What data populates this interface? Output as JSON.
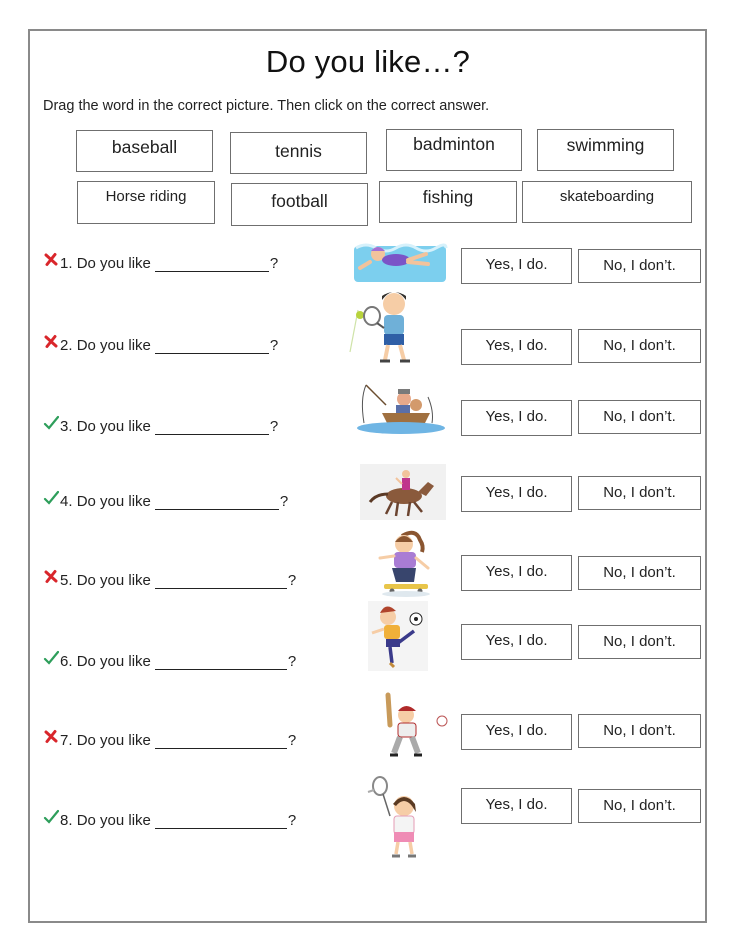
{
  "title": "Do you like…?",
  "instruction": "Drag the word in the correct picture. Then click on the correct answer.",
  "word_bank": [
    {
      "label": "baseball"
    },
    {
      "label": "tennis"
    },
    {
      "label": "badminton"
    },
    {
      "label": "swimming"
    },
    {
      "label": "Horse riding"
    },
    {
      "label": "football"
    },
    {
      "label": "fishing"
    },
    {
      "label": "skateboarding"
    }
  ],
  "answer_options": {
    "yes": "Yes, I do.",
    "no": "No, I don’t."
  },
  "questions": [
    {
      "number": "1.",
      "text": "Do you like",
      "end": "?",
      "status": "incorrect",
      "picture": "swimming-picture"
    },
    {
      "number": "2.",
      "text": "Do you like",
      "end": "?",
      "status": "incorrect",
      "picture": "tennis-picture"
    },
    {
      "number": "3.",
      "text": "Do you like",
      "end": "?",
      "status": "correct",
      "picture": "fishing-picture"
    },
    {
      "number": "4.",
      "text": "Do you like",
      "end": "?",
      "status": "correct",
      "picture": "horse-riding-picture"
    },
    {
      "number": "5.",
      "text": "Do you like",
      "end": "?",
      "status": "incorrect",
      "picture": "skateboarding-picture"
    },
    {
      "number": "6.",
      "text": "Do you like",
      "end": "?",
      "status": "correct",
      "picture": "football-picture"
    },
    {
      "number": "7.",
      "text": "Do you like",
      "end": "?",
      "status": "incorrect",
      "picture": "baseball-picture"
    },
    {
      "number": "8.",
      "text": "Do you like",
      "end": "?",
      "status": "correct",
      "picture": "badminton-picture"
    }
  ],
  "colors": {
    "correct": "#2e9e5b",
    "incorrect": "#d9262b",
    "border": "#8a8a8a"
  }
}
